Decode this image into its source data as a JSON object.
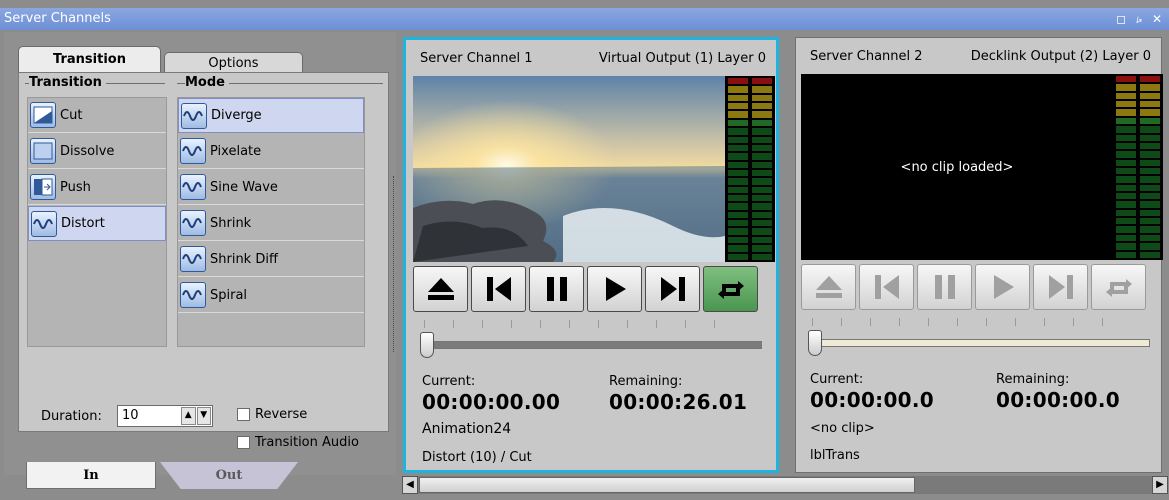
{
  "window": {
    "title": "Server Channels",
    "controls": "◻ ⭟ ✕"
  },
  "settings": {
    "tabs": {
      "transition": "Transition",
      "options": "Options"
    },
    "transition_header": "Transition",
    "mode_header": "Mode",
    "transitions": [
      {
        "label": "Cut",
        "icon": "cut-icon"
      },
      {
        "label": "Dissolve",
        "icon": "dissolve-icon"
      },
      {
        "label": "Push",
        "icon": "push-icon"
      },
      {
        "label": "Distort",
        "icon": "distort-icon",
        "selected": true
      }
    ],
    "modes": [
      {
        "label": "Diverge",
        "icon": "wave-icon",
        "selected": true
      },
      {
        "label": "Pixelate",
        "icon": "wave-icon"
      },
      {
        "label": "Sine Wave",
        "icon": "wave-icon"
      },
      {
        "label": "Shrink",
        "icon": "wave-icon"
      },
      {
        "label": "Shrink Diff",
        "icon": "wave-icon"
      },
      {
        "label": "Spiral",
        "icon": "wave-icon"
      }
    ],
    "duration_label": "Duration:",
    "duration_value": "10",
    "reverse_label": "Reverse",
    "transition_audio_label": "Transition Audio",
    "bottom_tabs": {
      "in": "In",
      "out": "Out"
    }
  },
  "channels": [
    {
      "name": "Server Channel 1",
      "output": "Virtual Output (1) Layer 0",
      "current_label": "Current:",
      "current": "00:00:00.00",
      "remaining_label": "Remaining:",
      "remaining": "00:00:26.01",
      "clip": "Animation24",
      "transition": "Distort (10) / Cut",
      "no_clip_text": "",
      "loop_active": true,
      "accent": "#1eb4e0"
    },
    {
      "name": "Server Channel 2",
      "output": "Decklink Output (2) Layer 0",
      "current_label": "Current:",
      "current": "00:00:00.0",
      "remaining_label": "Remaining:",
      "remaining": "00:00:00.0",
      "clip": "<no clip>",
      "transition": "lblTrans",
      "no_clip_text": "<no clip loaded>",
      "loop_active": false
    }
  ]
}
